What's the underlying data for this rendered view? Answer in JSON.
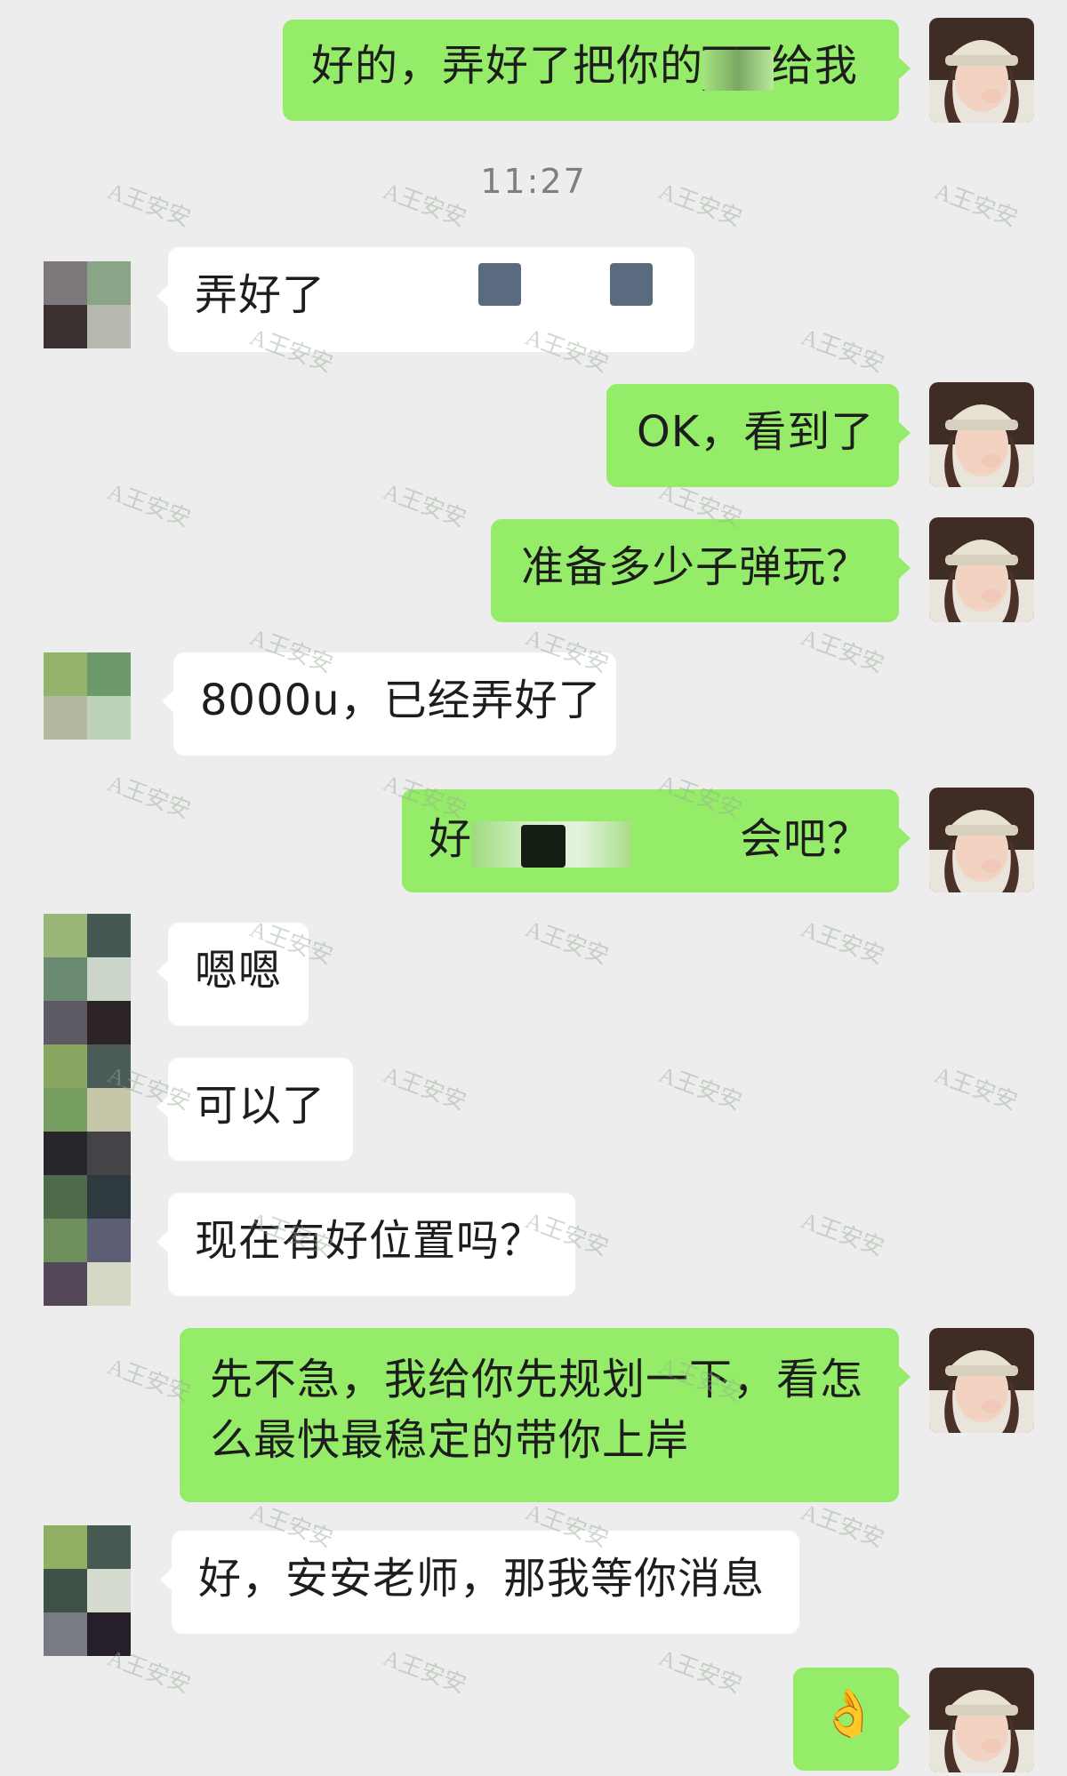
{
  "timestamp": "11:27",
  "watermark": "A王安安",
  "messages": [
    {
      "sender": "me",
      "text": "好的，弄好了把你的▇▇给我"
    },
    {
      "sender": "contact",
      "text": "弄好了"
    },
    {
      "sender": "me",
      "text": "OK，看到了"
    },
    {
      "sender": "me",
      "text": "准备多少子弹玩？"
    },
    {
      "sender": "contact",
      "text": "8000u，已经弄好了"
    },
    {
      "sender": "me",
      "text_start": "好",
      "text_end": "会吧？"
    },
    {
      "sender": "contact",
      "text": "嗯嗯"
    },
    {
      "sender": "contact",
      "text": "可以了"
    },
    {
      "sender": "contact",
      "text": "现在有好位置吗？"
    },
    {
      "sender": "me",
      "line1": "先不急，我给你先规划一下，看怎",
      "line2": "么最快最稳定的带你上岸"
    },
    {
      "sender": "contact",
      "text": "好，安安老师，那我等你消息"
    },
    {
      "sender": "me",
      "emoji": "👌"
    }
  ],
  "colors": {
    "background": "#ededed",
    "my_bubble": "#95ec69",
    "their_bubble": "#ffffff",
    "timestamp_text": "#7f7f7f"
  },
  "icons": {
    "my_avatar": "user-avatar-photo",
    "contact_avatar": "pixelated-avatar"
  }
}
